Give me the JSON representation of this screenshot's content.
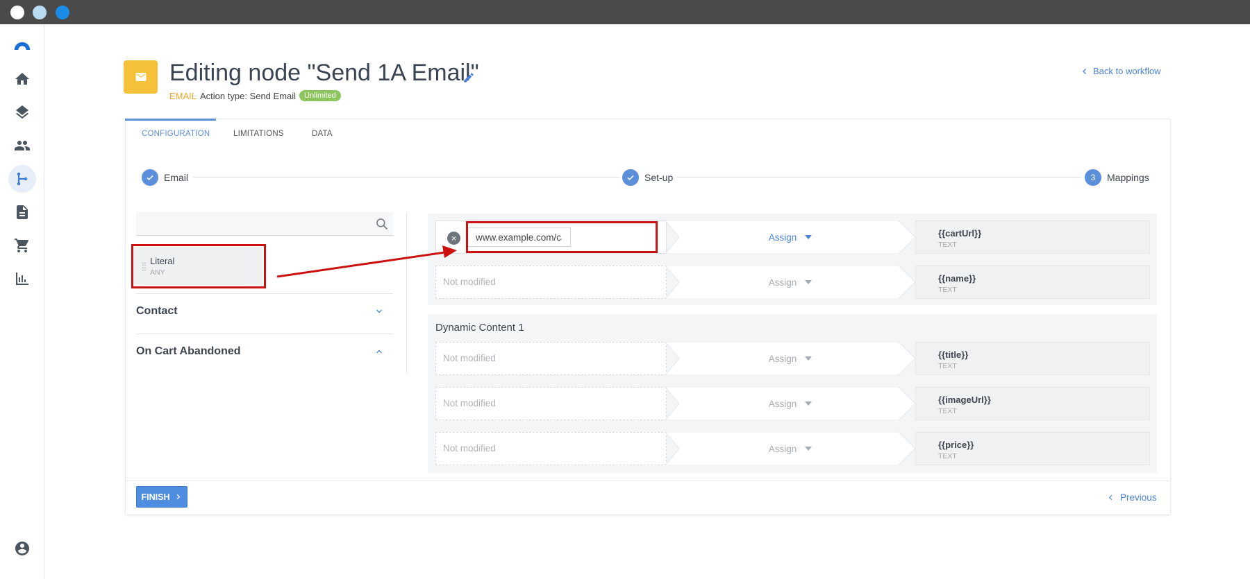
{
  "window": {
    "dots": [
      "#ffffff",
      "#b9dcf4",
      "#1a8ce6"
    ]
  },
  "sidebar": {
    "items": [
      "home-icon",
      "layers-icon",
      "contacts-icon",
      "workflow-icon",
      "document-icon",
      "cart-icon",
      "chart-icon"
    ],
    "active": "workflow-icon",
    "bottom": "account-icon"
  },
  "header": {
    "title": "Editing node \"Send 1A Email\"",
    "type_tag": "EMAIL",
    "action_type": "Action type: Send Email",
    "badge": "Unlimited",
    "back_link": "Back to workflow"
  },
  "tabs": [
    {
      "label": "CONFIGURATION",
      "active": true
    },
    {
      "label": "LIMITATIONS",
      "active": false
    },
    {
      "label": "DATA",
      "active": false
    }
  ],
  "steps": [
    {
      "label": "Email",
      "state": "done"
    },
    {
      "label": "Set-up",
      "state": "done"
    },
    {
      "label": "Mappings",
      "state": "current",
      "number": "3"
    }
  ],
  "left_panel": {
    "search_placeholder": "",
    "literal": {
      "title": "Literal",
      "subtitle": "ANY"
    },
    "sections": [
      {
        "title": "Contact",
        "expanded": false
      },
      {
        "title": "On Cart Abandoned",
        "expanded": true
      }
    ]
  },
  "mappings": {
    "group1": [
      {
        "value": "www.example.com/cart",
        "action": "Assign",
        "target": "{{cartUrl}}",
        "target_type": "TEXT"
      },
      {
        "source": "Not modified",
        "action": "Assign",
        "target": "{{name}}",
        "target_type": "TEXT"
      }
    ],
    "dynamic_title": "Dynamic Content 1",
    "group2": [
      {
        "source": "Not modified",
        "action": "Assign",
        "target": "{{title}}",
        "target_type": "TEXT"
      },
      {
        "source": "Not modified",
        "action": "Assign",
        "target": "{{imageUrl}}",
        "target_type": "TEXT"
      },
      {
        "source": "Not modified",
        "action": "Assign",
        "target": "{{price}}",
        "target_type": "TEXT"
      }
    ]
  },
  "footer": {
    "finish": "FINISH",
    "previous": "Previous"
  },
  "colors": {
    "accent": "#5b8fd9",
    "annotation": "#cc1111",
    "email_tag": "#f0a526",
    "badge": "#8cc55e",
    "node_icon": "#f5c03a"
  }
}
